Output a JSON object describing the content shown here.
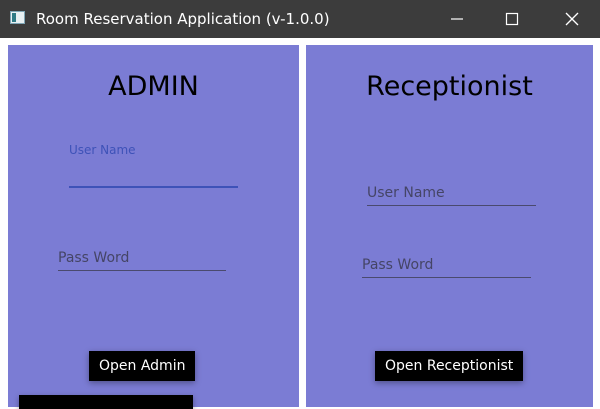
{
  "window": {
    "title": "Room Reservation Application (v-1.0.0)",
    "controls": {
      "minimize": "minimize-icon",
      "maximize": "maximize-icon",
      "close": "close-icon"
    }
  },
  "colors": {
    "titlebar": "#3c3c3c",
    "panel": "#7b7cd4",
    "accent": "#3e52b8",
    "button": "#000000"
  },
  "admin": {
    "heading": "ADMIN",
    "username": {
      "label": "User Name",
      "value": ""
    },
    "password": {
      "placeholder": "Pass Word",
      "value": ""
    },
    "open_button": "Open Admin"
  },
  "receptionist": {
    "heading": "Receptionist",
    "username": {
      "placeholder": "User Name",
      "value": ""
    },
    "password": {
      "placeholder": "Pass Word",
      "value": ""
    },
    "open_button": "Open Receptionist"
  }
}
